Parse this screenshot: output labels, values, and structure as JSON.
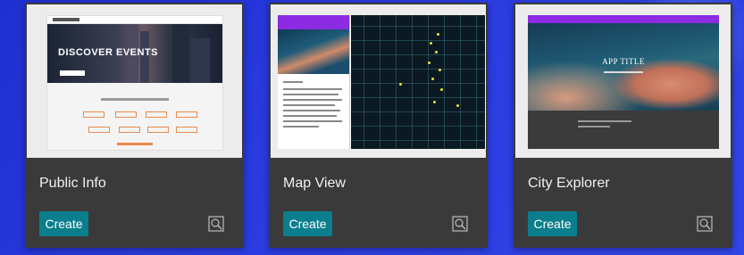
{
  "cards": [
    {
      "title": "Public Info",
      "create_label": "Create",
      "thumbnail": {
        "hero_text": "DISCOVER EVENTS",
        "footer_accent": "#e88a4a"
      }
    },
    {
      "title": "Map View",
      "create_label": "Create",
      "thumbnail": {
        "header_color": "#8b2be2"
      }
    },
    {
      "title": "City Explorer",
      "create_label": "Create",
      "thumbnail": {
        "hero_text": "APP TITLE",
        "header_color": "#8b2be2"
      }
    }
  ],
  "icons": {
    "preview": "preview-magnifier-icon"
  },
  "colors": {
    "background": "#2a3be0",
    "card": "#3a3a3a",
    "create_button": "#0a7e8c"
  }
}
